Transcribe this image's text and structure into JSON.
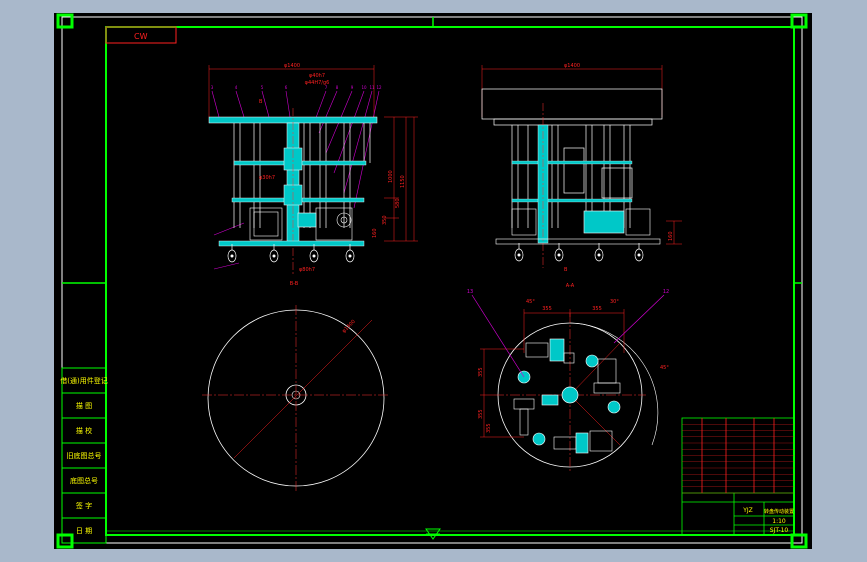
{
  "viewport": {
    "background": "#000000",
    "outer_background": "#a9b8cb"
  },
  "colors": {
    "frame": "#00ff00",
    "line": "#ffffff",
    "dim": "#ff2020",
    "leader": "#d000d0",
    "section": "#00c8c8",
    "centerline": "#ff3030",
    "title_text": "#ffff00"
  },
  "frame": {
    "code_box": "CW"
  },
  "front_view": {
    "width_dim": "φ1400",
    "shaft_dim_top": "φ40h7",
    "shaft_dim_bore": "φ44H7/g6",
    "shaft_dim_mid": "φ30h7",
    "shaft_dim_bottom": "φ80h7",
    "height_dims": [
      "1000",
      "1150",
      "580",
      "350",
      "160"
    ],
    "balloons": [
      "3",
      "4",
      "5",
      "6",
      "7",
      "8",
      "9",
      "10",
      "11",
      "12"
    ],
    "section_label": "B-B",
    "section_mark": "B"
  },
  "side_view": {
    "width_dim": "φ1400",
    "height_dim": "160",
    "cut_mark": "B"
  },
  "plan_view": {
    "diameter_dim": "φ1400"
  },
  "section_view": {
    "section_label": "A-A",
    "dims_top": [
      "355",
      "355"
    ],
    "dims_left": [
      "355",
      "355",
      "355"
    ],
    "angles": [
      "45°",
      "30°",
      "45°"
    ],
    "balloons": [
      "13",
      "12"
    ]
  },
  "side_table": {
    "rows": [
      "借(通)用件登记",
      "描 图",
      "描 校",
      "旧底图总号",
      "底图总号",
      "签 字",
      "日 期"
    ]
  },
  "title_block": {
    "title": "转盘传动装置",
    "scale": "1:10",
    "drawing_no": "SJT-10",
    "subtitle": "YJZ"
  },
  "icons": {
    "zone_triangle": "triangle-marker-icon"
  }
}
